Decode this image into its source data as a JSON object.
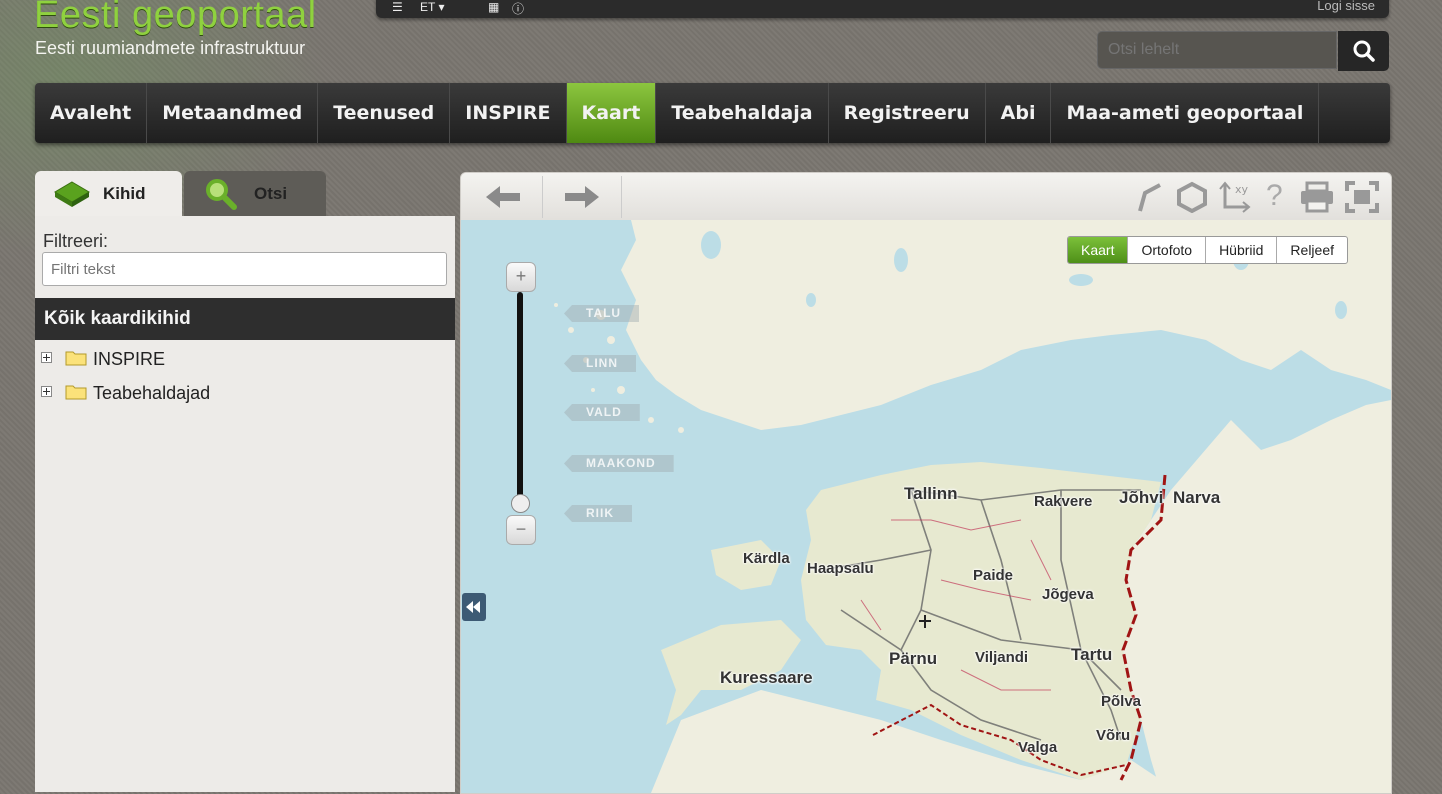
{
  "header": {
    "logo_title": "Eesti geoportaal",
    "logo_subtitle": "Eesti ruumiandmete infrastruktuur",
    "login_link": "Logi sisse"
  },
  "search": {
    "placeholder": "Otsi lehelt"
  },
  "nav": {
    "items": [
      {
        "label": "Avaleht",
        "active": false
      },
      {
        "label": "Metaandmed",
        "active": false
      },
      {
        "label": "Teenused",
        "active": false
      },
      {
        "label": "INSPIRE",
        "active": false
      },
      {
        "label": "Kaart",
        "active": true
      },
      {
        "label": "Teabehaldaja",
        "active": false
      },
      {
        "label": "Registreeru",
        "active": false
      },
      {
        "label": "Abi",
        "active": false
      },
      {
        "label": "Maa-ameti geoportaal",
        "active": false
      }
    ]
  },
  "left_panel": {
    "tabs": [
      {
        "label": "Kihid",
        "icon": "layers-icon",
        "active": true
      },
      {
        "label": "Otsi",
        "icon": "magnifier-icon",
        "active": false
      }
    ],
    "filter_label": "Filtreeri:",
    "filter_placeholder": "Filtri tekst",
    "layers_heading": "Kõik kaardikihid",
    "tree": [
      {
        "label": "INSPIRE",
        "icon": "folder-icon"
      },
      {
        "label": "Teabehaldajad",
        "icon": "folder-icon"
      }
    ]
  },
  "map": {
    "base_layers": [
      {
        "label": "Kaart",
        "active": true
      },
      {
        "label": "Ortofoto",
        "active": false
      },
      {
        "label": "Hübriid",
        "active": false
      },
      {
        "label": "Reljeef",
        "active": false
      }
    ],
    "zoom_in": "+",
    "zoom_out": "−",
    "scale_labels": [
      "TALU",
      "LINN",
      "VALD",
      "MAAKOND",
      "RIIK"
    ],
    "cities": [
      "Tallinn",
      "Rakvere",
      "Jõhvi",
      "Narva",
      "Kärdla",
      "Haapsalu",
      "Paide",
      "Jõgeva",
      "Pärnu",
      "Viljandi",
      "Tartu",
      "Kuressaare",
      "Põlva",
      "Võru",
      "Valga"
    ],
    "toolbar_icons": [
      "back-arrow-icon",
      "forward-arrow-icon",
      "measure-line-icon",
      "measure-area-icon",
      "coordinates-icon",
      "help-icon",
      "print-icon",
      "fullscreen-icon"
    ],
    "colors": {
      "water": "#bcdde6",
      "land": "#efeee0",
      "border": "#a01414",
      "active_green": "#6aaa2a"
    }
  }
}
